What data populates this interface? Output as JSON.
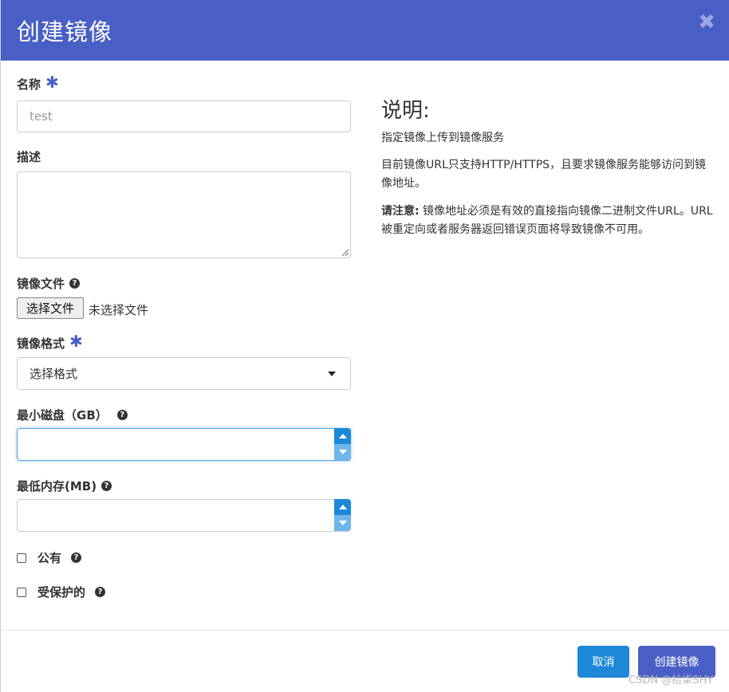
{
  "header": {
    "title": "创建镜像",
    "close_icon": "✖"
  },
  "form": {
    "name": {
      "label": "名称",
      "required": "✱",
      "placeholder": "test"
    },
    "description": {
      "label": "描述"
    },
    "image_file": {
      "label": "镜像文件",
      "button": "选择文件",
      "status": "未选择文件"
    },
    "format": {
      "label": "镜像格式",
      "required": "✱",
      "selected": "选择格式"
    },
    "min_disk": {
      "label": "最小磁盘（GB）"
    },
    "min_ram": {
      "label": "最低内存(MB)"
    },
    "public": {
      "label": "公有"
    },
    "protected": {
      "label": "受保护的"
    },
    "help_glyph": "?"
  },
  "info": {
    "title": "说明:",
    "p1": "指定镜像上传到镜像服务",
    "p2": "目前镜像URL只支持HTTP/HTTPS，且要求镜像服务能够访问到镜像地址。",
    "p3_bold": "请注意:",
    "p3": " 镜像地址必须是有效的直接指向镜像二进制文件URL。URL被重定向或者服务器返回错误页面将导致镜像不可用。"
  },
  "footer": {
    "cancel": "取消",
    "create": "创建镜像"
  },
  "watermark": "CSDN @拾柒SHY",
  "colors": {
    "header": "#4a5fc5",
    "primary_button": "#1d88d8",
    "create_button": "#4a5fc5"
  }
}
